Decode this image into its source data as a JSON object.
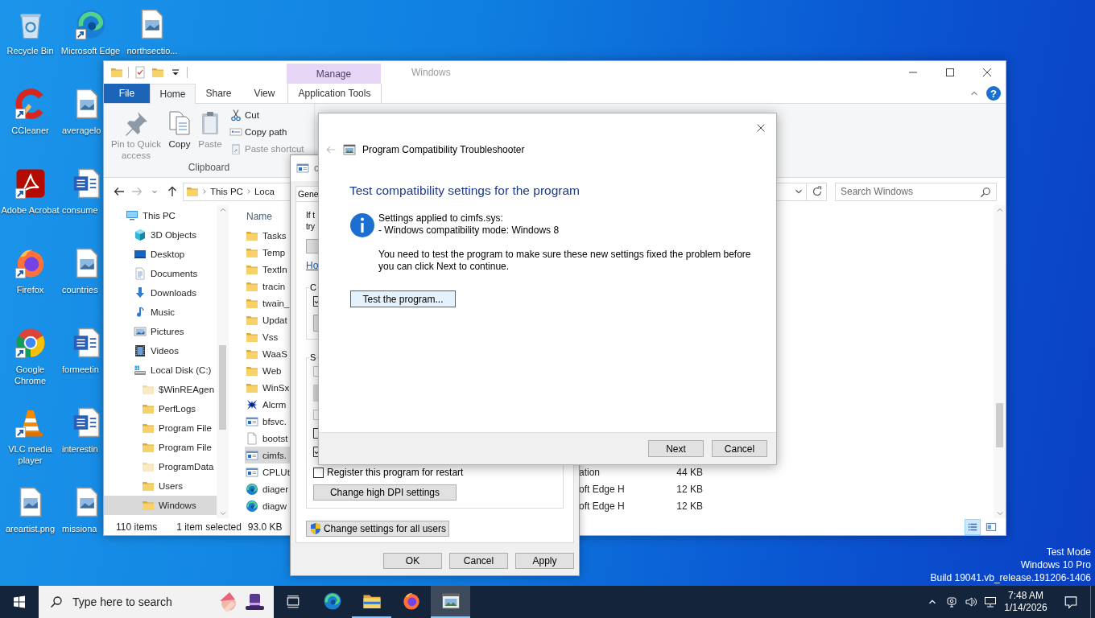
{
  "desktop": {
    "icon_columns": [
      [
        {
          "label": "Recycle Bin",
          "kind": "recycle",
          "shortcut": false
        },
        {
          "label": "CCleaner",
          "kind": "ccleaner",
          "shortcut": true
        },
        {
          "label": "Adobe Acrobat",
          "kind": "acrobat",
          "shortcut": true
        },
        {
          "label": "Firefox",
          "kind": "firefox",
          "shortcut": true
        },
        {
          "label": "Google Chrome",
          "kind": "chrome",
          "shortcut": true
        },
        {
          "label": "VLC media player",
          "kind": "vlc",
          "shortcut": true
        },
        {
          "label": "areartist.png",
          "kind": "image",
          "shortcut": false
        }
      ],
      [
        {
          "label": "Microsoft Edge",
          "kind": "edge",
          "shortcut": true
        },
        {
          "label": "averagelo",
          "kind": "image",
          "shortcut": false
        },
        {
          "label": "consume",
          "kind": "word",
          "shortcut": false
        },
        {
          "label": "countries",
          "kind": "image",
          "shortcut": false
        },
        {
          "label": "formeetin",
          "kind": "word",
          "shortcut": false
        },
        {
          "label": "interestin",
          "kind": "word",
          "shortcut": false
        },
        {
          "label": "missiona",
          "kind": "image",
          "shortcut": false
        }
      ],
      [
        {
          "label": "northsectio...",
          "kind": "image",
          "shortcut": false
        }
      ]
    ],
    "system_info": [
      "Test Mode",
      "Windows 10 Pro",
      "Build 19041.vb_release.191206-1406"
    ]
  },
  "explorer": {
    "context_tab_group": "Manage",
    "title": "Windows",
    "help_glyph": "?",
    "tabs": [
      {
        "label": "File",
        "kind": "file",
        "selected": false
      },
      {
        "label": "Home",
        "kind": "plain",
        "selected": true
      },
      {
        "label": "Share",
        "kind": "plain",
        "selected": false
      },
      {
        "label": "View",
        "kind": "plain",
        "selected": false
      },
      {
        "label": "Application Tools",
        "kind": "context",
        "selected": false
      }
    ],
    "clipboard": {
      "group_label": "Clipboard",
      "large": [
        {
          "label": "Pin to Quick access",
          "kind": "pin",
          "disabled": true
        },
        {
          "label": "Copy",
          "kind": "copy",
          "disabled": false
        },
        {
          "label": "Paste",
          "kind": "paste",
          "disabled": true
        }
      ],
      "small": [
        {
          "label": "Cut",
          "kind": "cut",
          "disabled": false
        },
        {
          "label": "Copy path",
          "kind": "copypath",
          "disabled": false
        },
        {
          "label": "Paste shortcut",
          "kind": "pasteshortcut",
          "disabled": true
        }
      ]
    },
    "nav_buttons": [
      {
        "kind": "back",
        "disabled": false
      },
      {
        "kind": "forward",
        "disabled": true
      },
      {
        "kind": "recent",
        "disabled": false
      },
      {
        "kind": "up",
        "disabled": false
      }
    ],
    "breadcrumb": [
      "This PC",
      "Loca"
    ],
    "search": {
      "placeholder": "Search Windows"
    },
    "nav": [
      {
        "label": "This PC",
        "kind": "pc",
        "selected": false,
        "children": [
          {
            "label": "3D Objects",
            "kind": "objects3d",
            "selected": false
          },
          {
            "label": "Desktop",
            "kind": "desktop",
            "selected": false
          },
          {
            "label": "Documents",
            "kind": "documents",
            "selected": false
          },
          {
            "label": "Downloads",
            "kind": "downloads",
            "selected": false
          },
          {
            "label": "Music",
            "kind": "music",
            "selected": false
          },
          {
            "label": "Pictures",
            "kind": "pictures",
            "selected": false
          },
          {
            "label": "Videos",
            "kind": "videos",
            "selected": false
          },
          {
            "label": "Local Disk (C:)",
            "kind": "disk",
            "selected": false,
            "children": [
              {
                "label": "$WinREAgen",
                "kind": "hidden_folder",
                "selected": false
              },
              {
                "label": "PerfLogs",
                "kind": "folder",
                "selected": false
              },
              {
                "label": "Program File",
                "kind": "folder",
                "selected": false
              },
              {
                "label": "Program File",
                "kind": "folder",
                "selected": false
              },
              {
                "label": "ProgramData",
                "kind": "hidden_folder",
                "selected": false
              },
              {
                "label": "Users",
                "kind": "folder",
                "selected": false
              },
              {
                "label": "Windows",
                "kind": "folder",
                "selected": true
              }
            ]
          }
        ]
      }
    ],
    "name_header": "Name",
    "files": [
      {
        "name": "Tasks",
        "kind": "folder",
        "selected": false
      },
      {
        "name": "Temp",
        "kind": "folder",
        "selected": false
      },
      {
        "name": "TextIn",
        "kind": "folder",
        "selected": false
      },
      {
        "name": "tracin",
        "kind": "folder",
        "selected": false
      },
      {
        "name": "twain_",
        "kind": "folder",
        "selected": false
      },
      {
        "name": "Updat",
        "kind": "folder",
        "selected": false
      },
      {
        "name": "Vss",
        "kind": "folder",
        "selected": false
      },
      {
        "name": "WaaS",
        "kind": "folder",
        "selected": false
      },
      {
        "name": "Web",
        "kind": "folder",
        "selected": false
      },
      {
        "name": "WinSx",
        "kind": "folder",
        "selected": false
      },
      {
        "name": "Alcrm",
        "kind": "alcrm",
        "selected": false
      },
      {
        "name": "bfsvc.",
        "kind": "app",
        "selected": false
      },
      {
        "name": "bootst",
        "kind": "file",
        "selected": false
      },
      {
        "name": "cimfs.",
        "kind": "app",
        "selected": true
      },
      {
        "name": "CPLUt",
        "kind": "app",
        "selected": false,
        "type": "ation",
        "size": "44 KB"
      },
      {
        "name": "diager",
        "kind": "edge",
        "selected": false,
        "type": "oft Edge H",
        "size": "12 KB"
      },
      {
        "name": "diagw",
        "kind": "edge",
        "selected": false,
        "type": "oft Edge H",
        "size": "12 KB"
      }
    ],
    "status": {
      "count": "110 items",
      "selection": "1 item selected",
      "size": "93.0 KB"
    },
    "views": [
      {
        "kind": "details",
        "selected": true
      },
      {
        "kind": "tiles",
        "selected": false
      }
    ]
  },
  "properties_dialog": {
    "title": "c",
    "tab": "Gene",
    "intro_lines": [
      "If t",
      "try"
    ],
    "link": "Ho",
    "groups": [
      {
        "label": "C",
        "items": [
          {
            "kind": "checkbox",
            "checked": true,
            "disabled": false
          },
          {
            "kind": "dropdown",
            "disabled": false
          }
        ]
      },
      {
        "label": "S",
        "items": [
          {
            "kind": "checkbox",
            "checked": false,
            "disabled": true
          },
          {
            "kind": "dropdown",
            "disabled": true
          },
          {
            "kind": "checkbox",
            "checked": false,
            "disabled": true
          },
          {
            "kind": "checkbox",
            "checked": false,
            "disabled": false
          },
          {
            "kind": "checkbox",
            "checked": true,
            "disabled": false
          },
          {
            "kind": "checkbox",
            "checked": false,
            "disabled": false,
            "label": "Register this program for restart"
          }
        ]
      }
    ],
    "dpi_button": "Change high DPI settings",
    "all_users_button": "Change settings for all users",
    "buttons": [
      "OK",
      "Cancel",
      "Apply"
    ]
  },
  "troubleshooter": {
    "title": "Program Compatibility Troubleshooter",
    "back_disabled": true,
    "heading": "Test compatibility settings for the program",
    "info_lines": [
      "Settings applied to cimfs.sys:",
      "- Windows compatibility mode: Windows 8"
    ],
    "note": "You need to test the program to make sure these new settings fixed the problem before you can click Next to continue.",
    "test_button": "Test the program...",
    "buttons": [
      "Next",
      "Cancel"
    ]
  },
  "taskbar": {
    "search_placeholder": "Type here to search",
    "apps": [
      {
        "kind": "edge",
        "running": false,
        "selected": false
      },
      {
        "kind": "explorer",
        "running": true,
        "selected": false
      },
      {
        "kind": "firefox",
        "running": false,
        "selected": false
      },
      {
        "kind": "troubleshooter",
        "running": true,
        "selected": true
      }
    ],
    "time": "7:48 AM",
    "date": "1/14/2026"
  }
}
